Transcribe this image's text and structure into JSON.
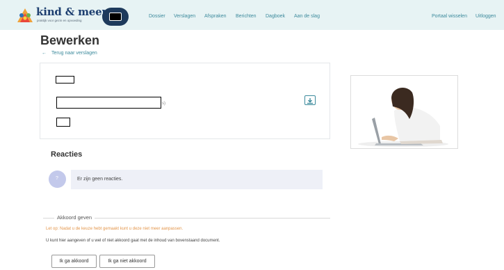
{
  "header": {
    "brand": "kind & meer",
    "brand_sub": "praktijk voor gezin en opvoeding",
    "nav": [
      "Dossier",
      "Verslagen",
      "Afspraken",
      "Berichten",
      "Dagboek",
      "Aan de slag"
    ],
    "right_nav": [
      "Portaal wisselen",
      "Uitloggen"
    ]
  },
  "page": {
    "title": "Bewerken",
    "back_link": "Terug naar verslagen"
  },
  "document": {
    "paren_fragment": "s)",
    "download_icon": "download-icon"
  },
  "reactions": {
    "title": "Reacties",
    "avatar_initial": "?",
    "empty_text": "Er zijn geen reacties."
  },
  "consent": {
    "legend": "Akkoord geven",
    "warning": "Let op: Nadat u de keuze hebt gemaakt kunt u deze niet meer aanpassen.",
    "info": "U kunt hier aangeven of u wel of niet akkoord gaat met de inhoud van bovenstaand document.",
    "agree_label": "Ik ga akkoord",
    "disagree_label": "Ik ga niet akkoord"
  },
  "colors": {
    "header_bg": "#e7f3f4",
    "link": "#3c8a9c",
    "brand": "#1d3f70",
    "warning": "#e3954a",
    "comment_bg": "#eef0f7"
  }
}
